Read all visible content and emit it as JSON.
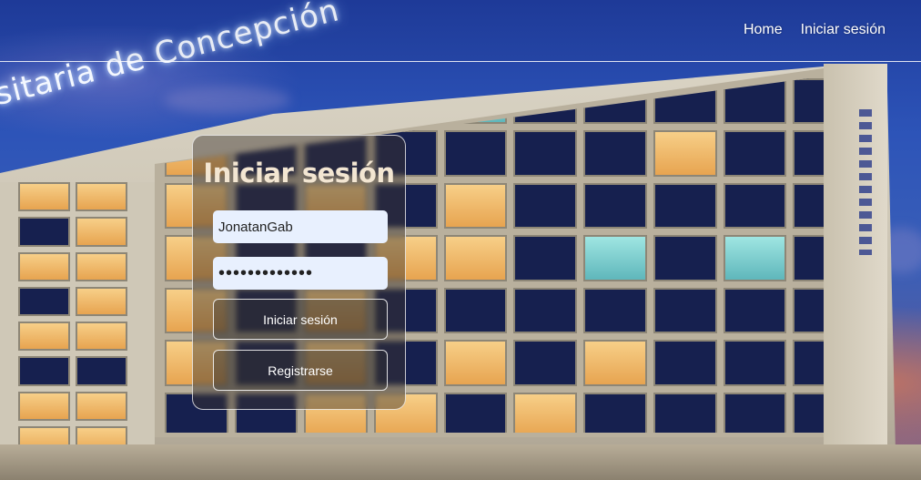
{
  "nav": {
    "home": "Home",
    "login": "Iniciar sesión"
  },
  "background": {
    "sign_text": "sitaria de Concepción"
  },
  "login_form": {
    "title": "Iniciar sesión",
    "username_value": "JonatanGab",
    "password_value": "•••••••••••••",
    "login_button": "Iniciar sesión",
    "register_button": "Registrarse"
  },
  "colors": {
    "title": "#f3e6d2",
    "input_background": "#e8f0fe",
    "button_border": "#ffffff"
  }
}
